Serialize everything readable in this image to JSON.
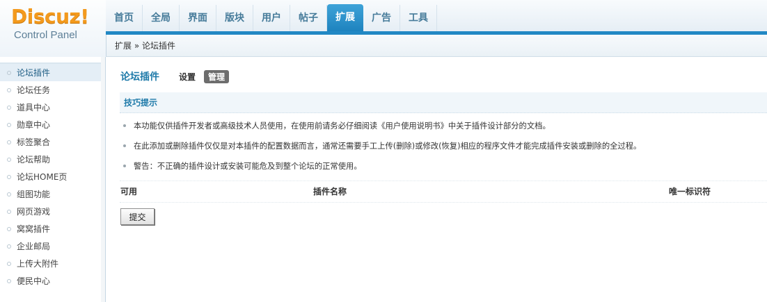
{
  "logo": {
    "main": "Discuz!",
    "sub": "Control Panel"
  },
  "topnav": {
    "items": [
      {
        "label": "首页"
      },
      {
        "label": "全局"
      },
      {
        "label": "界面"
      },
      {
        "label": "版块"
      },
      {
        "label": "用户"
      },
      {
        "label": "帖子"
      },
      {
        "label": "扩展"
      },
      {
        "label": "广告"
      },
      {
        "label": "工具"
      }
    ],
    "active_index": 6
  },
  "breadcrumb": "扩展 » 论坛插件",
  "sidebar": {
    "items": [
      {
        "label": "论坛插件"
      },
      {
        "label": "论坛任务"
      },
      {
        "label": "道具中心"
      },
      {
        "label": "勋章中心"
      },
      {
        "label": "标签聚合"
      },
      {
        "label": "论坛帮助"
      },
      {
        "label": "论坛HOME页"
      },
      {
        "label": "组图功能"
      },
      {
        "label": "网页游戏"
      },
      {
        "label": "窝窝插件"
      },
      {
        "label": "企业邮局"
      },
      {
        "label": "上传大附件"
      },
      {
        "label": "便民中心"
      }
    ],
    "active_index": 0
  },
  "main": {
    "title": "论坛插件",
    "tabs": {
      "settings": "设置",
      "manage": "管理"
    },
    "tips": {
      "title": "技巧提示",
      "items": [
        "本功能仅供插件开发者或高级技术人员使用，在使用前请务必仔细阅读《用户使用说明书》中关于插件设计部分的文档。",
        "在此添加或删除插件仅仅是对本插件的配置数据而言，通常还需要手工上传(删除)或修改(恢复)相应的程序文件才能完成插件安装或删除的全过程。",
        "警告：不正确的插件设计或安装可能危及到整个论坛的正常使用。"
      ]
    },
    "table": {
      "col_enabled": "可用",
      "col_name": "插件名称",
      "col_id": "唯一标识符"
    },
    "submit_label": "提交"
  },
  "colors": {
    "accent": "#1e7aa9",
    "nav_active": "#2288c4",
    "logo": "#f39a1d"
  }
}
